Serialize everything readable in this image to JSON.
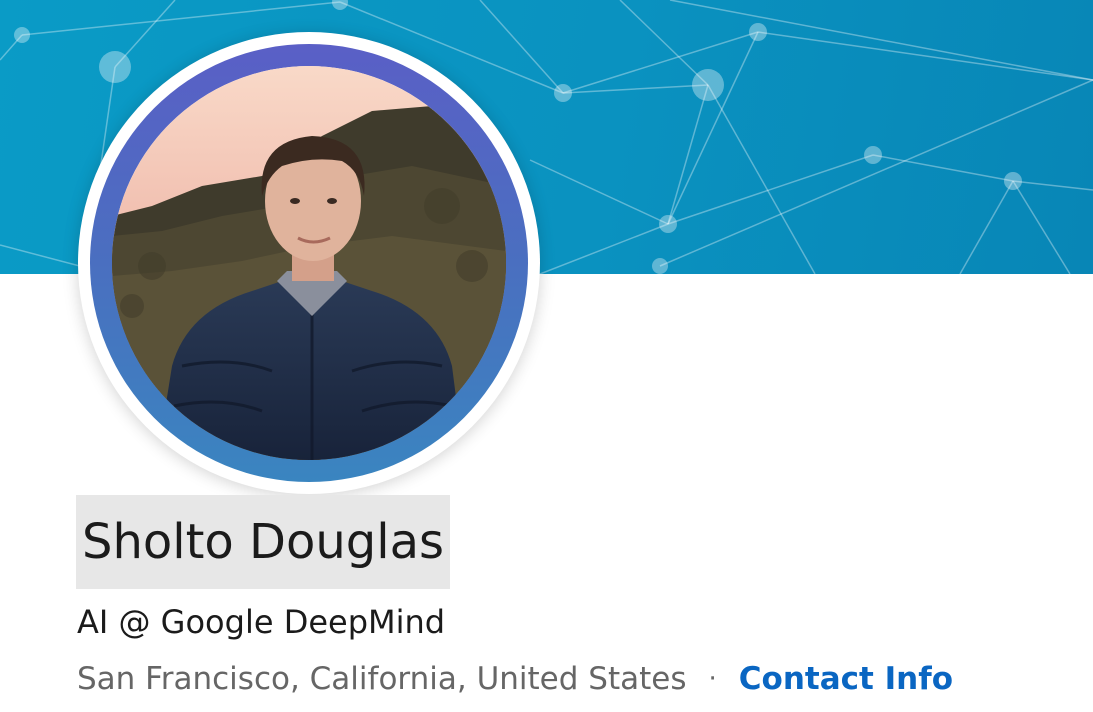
{
  "profile": {
    "name": "Sholto Douglas",
    "headline": "AI @ Google DeepMind",
    "location": "San Francisco, California, United States",
    "separator": "·",
    "contact_info_label": "Contact Info"
  },
  "colors": {
    "banner": "#0a9bc6",
    "avatar_ring": "#5a5fc6",
    "link": "#0a66c2",
    "name_highlight": "#e7e7e7"
  },
  "icons": {
    "banner": "network-pattern-background",
    "avatar": "profile-photo"
  }
}
